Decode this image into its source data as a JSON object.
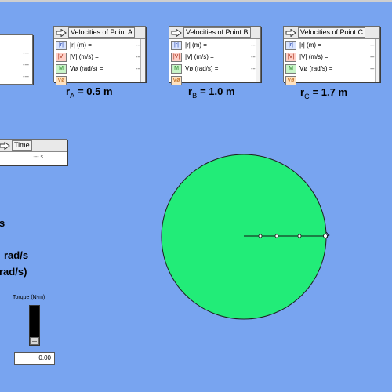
{
  "left_panel": {
    "values": [
      "---",
      "---",
      "---"
    ]
  },
  "panels": [
    {
      "title": "Velocities of Point A",
      "rows": [
        {
          "tag": "R",
          "label": "|r| (m) =",
          "value": "---"
        },
        {
          "tag": "V",
          "label": "|V| (m/s) =",
          "value": "---"
        },
        {
          "tag": "M",
          "label": "Vø (rad/s) =",
          "value": "---"
        }
      ],
      "radius_letter": "r",
      "radius_sub": "A",
      "radius_value": "= 0.5 m"
    },
    {
      "title": "Velocities of Point B",
      "rows": [
        {
          "tag": "R",
          "label": "|r| (m) =",
          "value": "---"
        },
        {
          "tag": "V",
          "label": "|V| (m/s) =",
          "value": "---"
        },
        {
          "tag": "M",
          "label": "Vø (rad/s) =",
          "value": "---"
        }
      ],
      "radius_letter": "r",
      "radius_sub": "B",
      "radius_value": "= 1.0 m"
    },
    {
      "title": "Velocities of Point C",
      "rows": [
        {
          "tag": "R",
          "label": "|r| (m) =",
          "value": "---"
        },
        {
          "tag": "V",
          "label": "|V| (m/s) =",
          "value": "---"
        },
        {
          "tag": "M",
          "label": "Vø (rad/s) =",
          "value": "---"
        }
      ],
      "radius_letter": "r",
      "radius_sub": "C",
      "radius_value": "= 1.7 m"
    }
  ],
  "time_panel": {
    "title": "Time",
    "value": "--- s"
  },
  "left_text": {
    "line1": "s",
    "line2": "rad/s",
    "line3": "rad/s)"
  },
  "torque": {
    "label": "Torque (N-m)",
    "value": "0.00",
    "level": 0
  },
  "disk": {
    "color": "#22ec78",
    "points": [
      "A",
      "B",
      "C"
    ]
  },
  "colors": {
    "background": "#78a4f0",
    "panel": "#ffffff"
  }
}
